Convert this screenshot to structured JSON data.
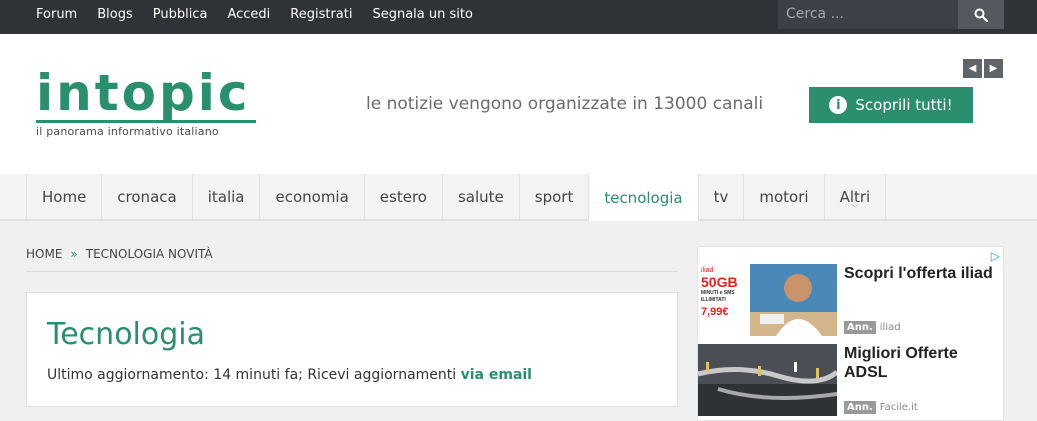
{
  "topnav": {
    "items": [
      "Forum",
      "Blogs",
      "Pubblica",
      "Accedi",
      "Registrati",
      "Segnala un sito"
    ],
    "search_placeholder": "Cerca ..."
  },
  "header": {
    "logo_text": "intopic",
    "logo_tagline": "il panorama informativo italiano",
    "tagline": "le notizie vengono organizzate in 13000 canali",
    "cta_label": "Scoprili tutti!"
  },
  "nav": {
    "items": [
      "Home",
      "cronaca",
      "italia",
      "economia",
      "estero",
      "salute",
      "sport",
      "tecnologia",
      "tv",
      "motori",
      "Altri"
    ],
    "active": "tecnologia"
  },
  "breadcrumb": {
    "home": "HOME",
    "current": "TECNOLOGIA NOVITÀ"
  },
  "main": {
    "title": "Tecnologia",
    "meta_prefix": "Ultimo aggiornamento: 14 minuti fa; Ricevi aggiornamenti",
    "meta_link": "via email"
  },
  "ad": {
    "items": [
      {
        "title": "Scopri l'offerta iliad",
        "badge": "Ann.",
        "source": "iliad",
        "image_text": {
          "brand": "iliad",
          "gb": "50GB",
          "sub": "MINUTI e SMS ILLIMITATI",
          "price": "7,99€"
        }
      },
      {
        "title": "Migliori Offerte ADSL",
        "badge": "Ann.",
        "source": "Facile.it"
      }
    ]
  },
  "colors": {
    "brand": "#2a8f6d",
    "topbar": "#2f3237"
  }
}
